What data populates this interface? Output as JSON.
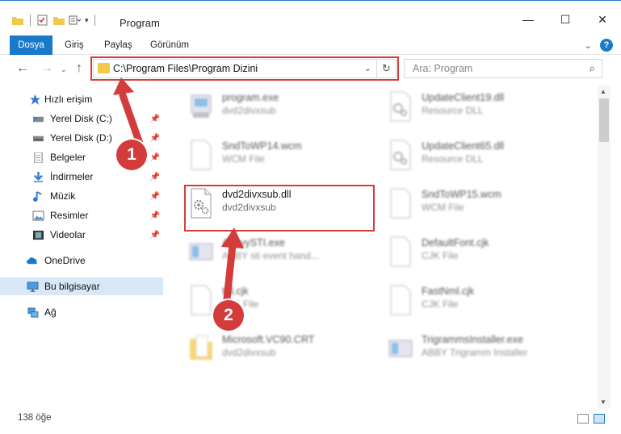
{
  "window": {
    "title": "Program"
  },
  "ribbon": {
    "tabs": [
      "Dosya",
      "Giriş",
      "Paylaş",
      "Görünüm"
    ]
  },
  "address": {
    "path": "C:\\Program Files\\Program Dizini"
  },
  "search": {
    "placeholder": "Ara: Program"
  },
  "sidebar": {
    "items": [
      {
        "label": "Hızlı erişim",
        "icon": "star-icon"
      },
      {
        "label": "Yerel Disk (C:)",
        "icon": "drive-icon",
        "pinned": true
      },
      {
        "label": "Yerel Disk (D:)",
        "icon": "drive-icon",
        "pinned": true
      },
      {
        "label": "Belgeler",
        "icon": "document-icon",
        "pinned": true
      },
      {
        "label": "İndirmeler",
        "icon": "download-icon",
        "pinned": true
      },
      {
        "label": "Müzik",
        "icon": "music-icon",
        "pinned": true
      },
      {
        "label": "Resimler",
        "icon": "pictures-icon",
        "pinned": true
      },
      {
        "label": "Videolar",
        "icon": "video-icon",
        "pinned": true
      },
      {
        "label": "OneDrive",
        "icon": "cloud-icon"
      },
      {
        "label": "Bu bilgisayar",
        "icon": "computer-icon",
        "selected": true
      },
      {
        "label": "Ağ",
        "icon": "network-icon"
      }
    ]
  },
  "files": [
    {
      "name": "program.exe",
      "type": "dvd2divxsub"
    },
    {
      "name": "UpdateClient19.dll",
      "type": "Resource DLL"
    },
    {
      "name": "SndToWP14.wcm",
      "type": "WCM File"
    },
    {
      "name": "UpdateClient65.dll",
      "type": "Resource DLL"
    },
    {
      "name": "dvd2divxsub.dll",
      "type": "dvd2divxsub"
    },
    {
      "name": "SndToWP15.wcm",
      "type": "WCM File"
    },
    {
      "name": "AbbyySTI.exe",
      "type": "ABBY sti event hand..."
    },
    {
      "name": "DefaultFont.cjk",
      "type": "CJK File"
    },
    {
      "name": "ttd.cjk",
      "type": "CJK File"
    },
    {
      "name": "FastNml.cjk",
      "type": "CJK File"
    },
    {
      "name": "Microsoft.VC90.CRT",
      "type": "dvd2divxsub"
    },
    {
      "name": "TrigrammsInstaller.exe",
      "type": "ABBY Trigramm Installer"
    }
  ],
  "status": {
    "count": "138 öğe"
  },
  "annotations": {
    "step1": "1",
    "step2": "2"
  },
  "colors": {
    "accent": "#1979ca",
    "highlight": "#d43c3c"
  }
}
